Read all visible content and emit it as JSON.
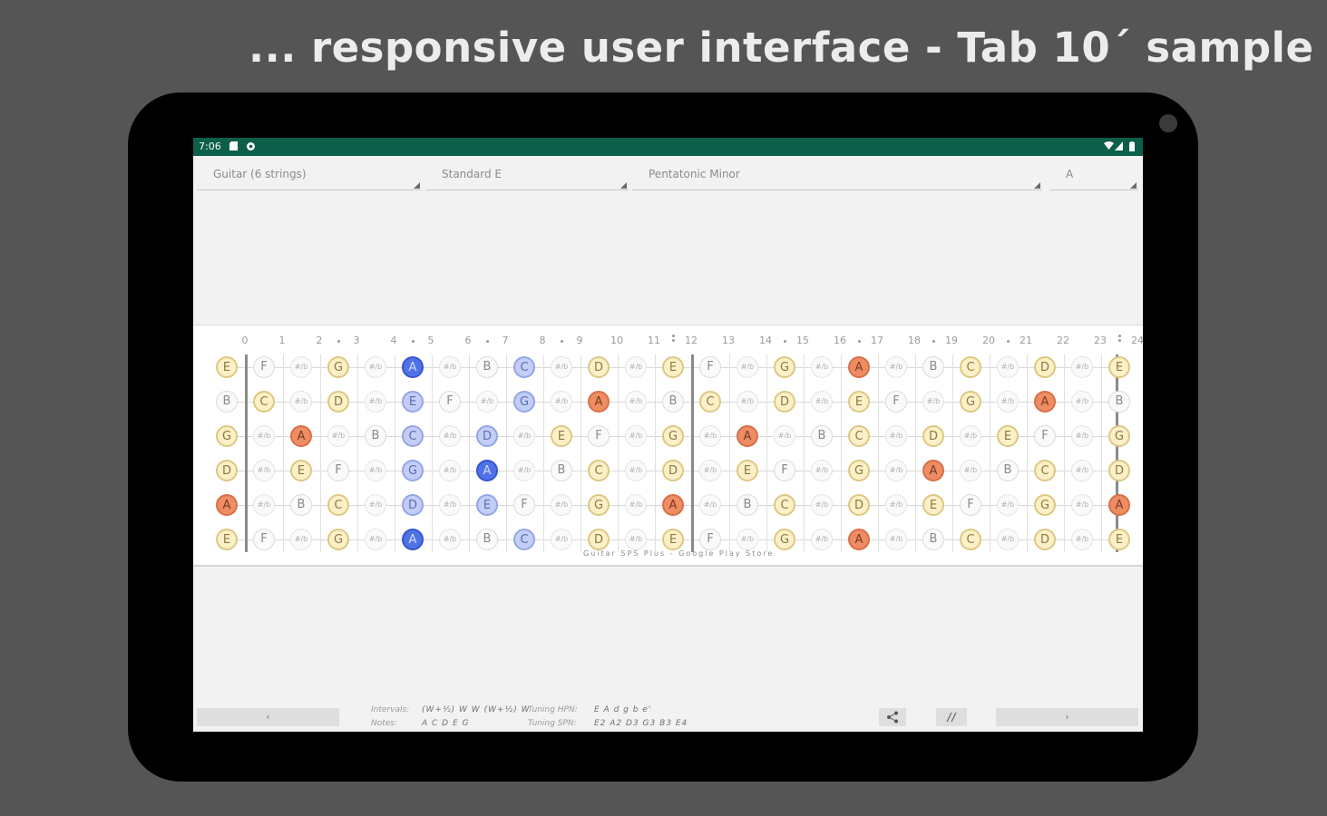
{
  "headline": "... responsive user interface - Tab 10´ sample",
  "status_bar": {
    "time": "7:06",
    "left_icons": [
      "sd-card-icon",
      "settings-gear-icon"
    ],
    "right_icons": [
      "wifi-icon",
      "signal-icon",
      "battery-icon"
    ]
  },
  "dropdowns": {
    "instrument": "Guitar (6 strings)",
    "tuning": "Standard E",
    "scale": "Pentatonic Minor",
    "key": "A"
  },
  "fretboard": {
    "fret_labels": [
      "0",
      "1",
      "2",
      "3",
      "4",
      "5",
      "6",
      "7",
      "8",
      "9",
      "10",
      "11",
      "12",
      "13",
      "14",
      "15",
      "16",
      "17",
      "18",
      "19",
      "20",
      "21",
      "22",
      "23",
      "24"
    ],
    "inlay_frets": [
      3,
      5,
      7,
      9,
      12,
      15,
      17,
      19,
      21,
      24
    ],
    "strings": [
      [
        "E",
        "F",
        "F#",
        "G",
        "G#",
        "A",
        "A#",
        "B",
        "C",
        "C#",
        "D",
        "D#",
        "E",
        "F",
        "F#",
        "G",
        "G#",
        "A",
        "A#",
        "B",
        "C",
        "C#",
        "D",
        "D#",
        "E"
      ],
      [
        "B",
        "C",
        "C#",
        "D",
        "D#",
        "E",
        "F",
        "F#",
        "G",
        "G#",
        "A",
        "A#",
        "B",
        "C",
        "C#",
        "D",
        "D#",
        "E",
        "F",
        "F#",
        "G",
        "G#",
        "A",
        "A#",
        "B"
      ],
      [
        "G",
        "G#",
        "A",
        "A#",
        "B",
        "C",
        "C#",
        "D",
        "D#",
        "E",
        "F",
        "F#",
        "G",
        "G#",
        "A",
        "A#",
        "B",
        "C",
        "C#",
        "D",
        "D#",
        "E",
        "F",
        "F#",
        "G"
      ],
      [
        "D",
        "D#",
        "E",
        "F",
        "F#",
        "G",
        "G#",
        "A",
        "A#",
        "B",
        "C",
        "C#",
        "D",
        "D#",
        "E",
        "F",
        "F#",
        "G",
        "G#",
        "A",
        "A#",
        "B",
        "C",
        "C#",
        "D"
      ],
      [
        "A",
        "A#",
        "B",
        "C",
        "C#",
        "D",
        "D#",
        "E",
        "F",
        "F#",
        "G",
        "G#",
        "A",
        "A#",
        "B",
        "C",
        "C#",
        "D",
        "D#",
        "E",
        "F",
        "F#",
        "G",
        "G#",
        "A"
      ],
      [
        "E",
        "F",
        "F#",
        "G",
        "G#",
        "A",
        "A#",
        "B",
        "C",
        "C#",
        "D",
        "D#",
        "E",
        "F",
        "F#",
        "G",
        "G#",
        "A",
        "A#",
        "B",
        "C",
        "C#",
        "D",
        "D#",
        "E"
      ]
    ],
    "accidental_glyph": "#/b",
    "highlights": [
      {
        "string": 0,
        "fret": 5,
        "style": "bdark"
      },
      {
        "string": 0,
        "fret": 8,
        "style": "blight"
      },
      {
        "string": 1,
        "fret": 5,
        "style": "blight"
      },
      {
        "string": 1,
        "fret": 8,
        "style": "blight"
      },
      {
        "string": 2,
        "fret": 5,
        "style": "blight"
      },
      {
        "string": 2,
        "fret": 7,
        "style": "blight"
      },
      {
        "string": 3,
        "fret": 5,
        "style": "blight"
      },
      {
        "string": 3,
        "fret": 7,
        "style": "bdark"
      },
      {
        "string": 4,
        "fret": 5,
        "style": "blight"
      },
      {
        "string": 4,
        "fret": 7,
        "style": "blight"
      },
      {
        "string": 5,
        "fret": 5,
        "style": "bdark"
      },
      {
        "string": 5,
        "fret": 8,
        "style": "blight"
      }
    ],
    "root_note": "A",
    "scale_notes": [
      "C",
      "D",
      "E",
      "G"
    ],
    "watermark": "Guitar SPS Plus  -  Google Play Store"
  },
  "bottom_bar": {
    "prev_label": "‹",
    "next_label": "›",
    "intervals_label": "Intervals:",
    "intervals_value": "(W+½) W W (W+½) W",
    "notes_label": "Notes:",
    "notes_value": "A C D E G",
    "tuning_hpn_label": "Tuning HPN:",
    "tuning_hpn_value": "E A d g b e'",
    "tuning_spn_label": "Tuning SPN:",
    "tuning_spn_value": "E2 A2 D3 G3 B3 E4",
    "share_icon": "share-icon",
    "fullscreen_icon": "fullscreen-icon"
  }
}
